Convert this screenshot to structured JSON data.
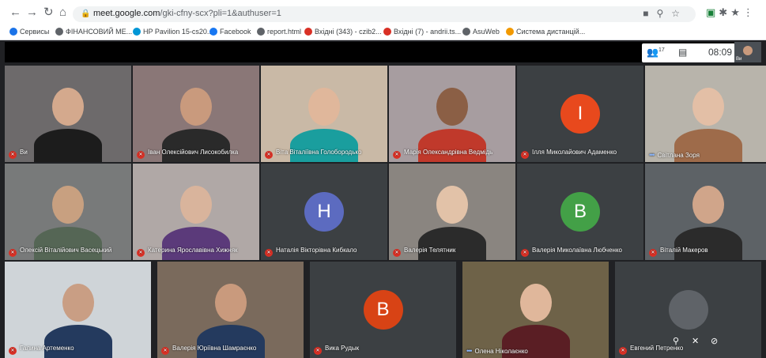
{
  "browser": {
    "url_host": "meet.google.com",
    "url_path": "/gki-cfny-scx?pli=1&authuser=1",
    "bookmarks": [
      {
        "label": "Сервисы",
        "color": "#1a73e8"
      },
      {
        "label": "ФІНАНСОВИЙ МЕ...",
        "color": "#5f6368"
      },
      {
        "label": "HP Pavilion 15-cs20...",
        "color": "#0096d6"
      },
      {
        "label": "Facebook",
        "color": "#1877f2"
      },
      {
        "label": "report.html",
        "color": "#5f6368"
      },
      {
        "label": "Вхідні (343) - czib2...",
        "color": "#d93025"
      },
      {
        "label": "Вхідні (7) - andrii.ts...",
        "color": "#d93025"
      },
      {
        "label": "AsuWeb",
        "color": "#5f6368"
      },
      {
        "label": "Система дистанцій...",
        "color": "#f29900"
      }
    ]
  },
  "meet": {
    "participant_count": "17",
    "time": "08:09",
    "self_label": "Ви",
    "participants": [
      {
        "name": "Ви",
        "video": true,
        "avatar_letter": "",
        "avatar_color": "",
        "bg": "#6d6a6b",
        "skin": "#d4a98d",
        "shirt": "#1c1c1c",
        "muted": true
      },
      {
        "name": "Іван Олексійович Лисокобилка",
        "video": true,
        "avatar_letter": "",
        "avatar_color": "",
        "bg": "#8a7777",
        "skin": "#c99a7d",
        "shirt": "#2a2a2a",
        "muted": true
      },
      {
        "name": "Віта Віталіївна Голобородько",
        "video": true,
        "avatar_letter": "",
        "avatar_color": "",
        "bg": "#c9b9a6",
        "skin": "#e0b79b",
        "shirt": "#1a9e9e",
        "muted": true
      },
      {
        "name": "Марія Олександрівна Ведмідь",
        "video": true,
        "avatar_letter": "",
        "avatar_color": "",
        "bg": "#a79da0",
        "skin": "#8b5f45",
        "shirt": "#c0392b",
        "muted": true
      },
      {
        "name": "Ілля Миколайович Адаменко",
        "video": false,
        "avatar_letter": "I",
        "avatar_color": "#e8491d",
        "bg": "",
        "skin": "",
        "shirt": "",
        "muted": true
      },
      {
        "name": "Світлана Зоря",
        "video": true,
        "avatar_letter": "",
        "avatar_color": "",
        "bg": "#b8b4ab",
        "skin": "#e3bfa6",
        "shirt": "#9e6b4a",
        "muted": false
      },
      {
        "name": "Олексій Віталійович Васецький",
        "video": true,
        "avatar_letter": "",
        "avatar_color": "",
        "bg": "#787a7a",
        "skin": "#c8a080",
        "shirt": "#556655",
        "muted": true
      },
      {
        "name": "Катерина Ярославівна Хижняк",
        "video": true,
        "avatar_letter": "",
        "avatar_color": "",
        "bg": "#b0a8a6",
        "skin": "#d9b49c",
        "shirt": "#5b3a7a",
        "muted": true
      },
      {
        "name": "Наталія Вікторівна Кибкало",
        "video": false,
        "avatar_letter": "H",
        "avatar_color": "#5c6bc0",
        "bg": "",
        "skin": "",
        "shirt": "",
        "muted": true
      },
      {
        "name": "Валерія Телятник",
        "video": true,
        "avatar_letter": "",
        "avatar_color": "",
        "bg": "#8a8580",
        "skin": "#e2c2a8",
        "shirt": "#2b2b2b",
        "muted": true
      },
      {
        "name": "Валерія Миколаївна Любченко",
        "video": false,
        "avatar_letter": "B",
        "avatar_color": "#43a047",
        "bg": "",
        "skin": "",
        "shirt": "",
        "muted": true
      },
      {
        "name": "Віталій Макеров",
        "video": true,
        "avatar_letter": "",
        "avatar_color": "",
        "bg": "#5d6266",
        "skin": "#d0a58a",
        "shirt": "#2b2b2b",
        "muted": true
      },
      {
        "name": "Галина Артеменко",
        "video": true,
        "avatar_letter": "",
        "avatar_color": "",
        "bg": "#cfd4d8",
        "skin": "#c99e84",
        "shirt": "#243a5e",
        "muted": true
      },
      {
        "name": "Валерія Юріївна Шамраєнко",
        "video": true,
        "avatar_letter": "",
        "avatar_color": "",
        "bg": "#7a6a5c",
        "skin": "#c99a7d",
        "shirt": "#243a5e",
        "muted": true
      },
      {
        "name": "Вика Рудык",
        "video": false,
        "avatar_letter": "B",
        "avatar_color": "#d84315",
        "bg": "",
        "skin": "",
        "shirt": "",
        "muted": true
      },
      {
        "name": "Олена Ніколаєнко",
        "video": true,
        "avatar_letter": "",
        "avatar_color": "",
        "bg": "#6e6248",
        "skin": "#e0b79b",
        "shirt": "#5a1e24",
        "muted": false
      },
      {
        "name": "Евгений Петренко",
        "video": false,
        "avatar_letter": "",
        "avatar_color": "#5f6368",
        "bg": "",
        "skin": "",
        "shirt": "",
        "muted": true
      }
    ]
  }
}
